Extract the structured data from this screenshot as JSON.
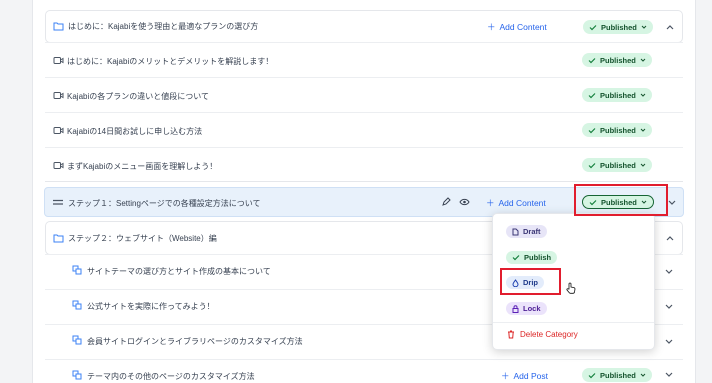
{
  "colors": {
    "accent": "#2563eb",
    "published_bg": "#d6f5e3",
    "published_text": "#14532d",
    "highlight_row": "#e8f1fb",
    "danger": "#dc2626",
    "callout": "#e11d2e"
  },
  "sections": [
    {
      "title": "はじめに：Kajabiを使う理由と最適なプランの選び方",
      "action": "Add Content",
      "status": "Published"
    },
    {
      "title": "ステップ１：Settingページでの各種設定方法について",
      "action": "Add Content",
      "status": "Published"
    },
    {
      "title": "ステップ２：ウェブサイト（Website）編"
    }
  ],
  "section1_items": [
    {
      "title": "はじめに：Kajabiのメリットとデメリットを解説します！",
      "status": "Published"
    },
    {
      "title": "Kajabiの各プランの違いと値段について",
      "status": "Published"
    },
    {
      "title": "Kajabiの14日間お試しに申し込む方法",
      "status": "Published"
    },
    {
      "title": "まずKajabiのメニュー画面を理解しよう！",
      "status": "Published"
    }
  ],
  "section3_items": [
    {
      "title": "サイトテーマの選び方とサイト作成の基本について"
    },
    {
      "title": "公式サイトを実際に作ってみよう！"
    },
    {
      "title": "会員サイトログインとライブラリページのカスタマイズ方法"
    },
    {
      "title": "テーマ内のその他のページのカスタマイズ方法",
      "action": "Add Post",
      "status": "Published"
    }
  ],
  "dropdown": {
    "options": [
      {
        "label": "Draft",
        "icon": "file-icon"
      },
      {
        "label": "Publish",
        "icon": "check-icon"
      },
      {
        "label": "Drip",
        "icon": "drop-icon"
      },
      {
        "label": "Lock",
        "icon": "lock-icon"
      }
    ],
    "delete_label": "Delete Category"
  }
}
